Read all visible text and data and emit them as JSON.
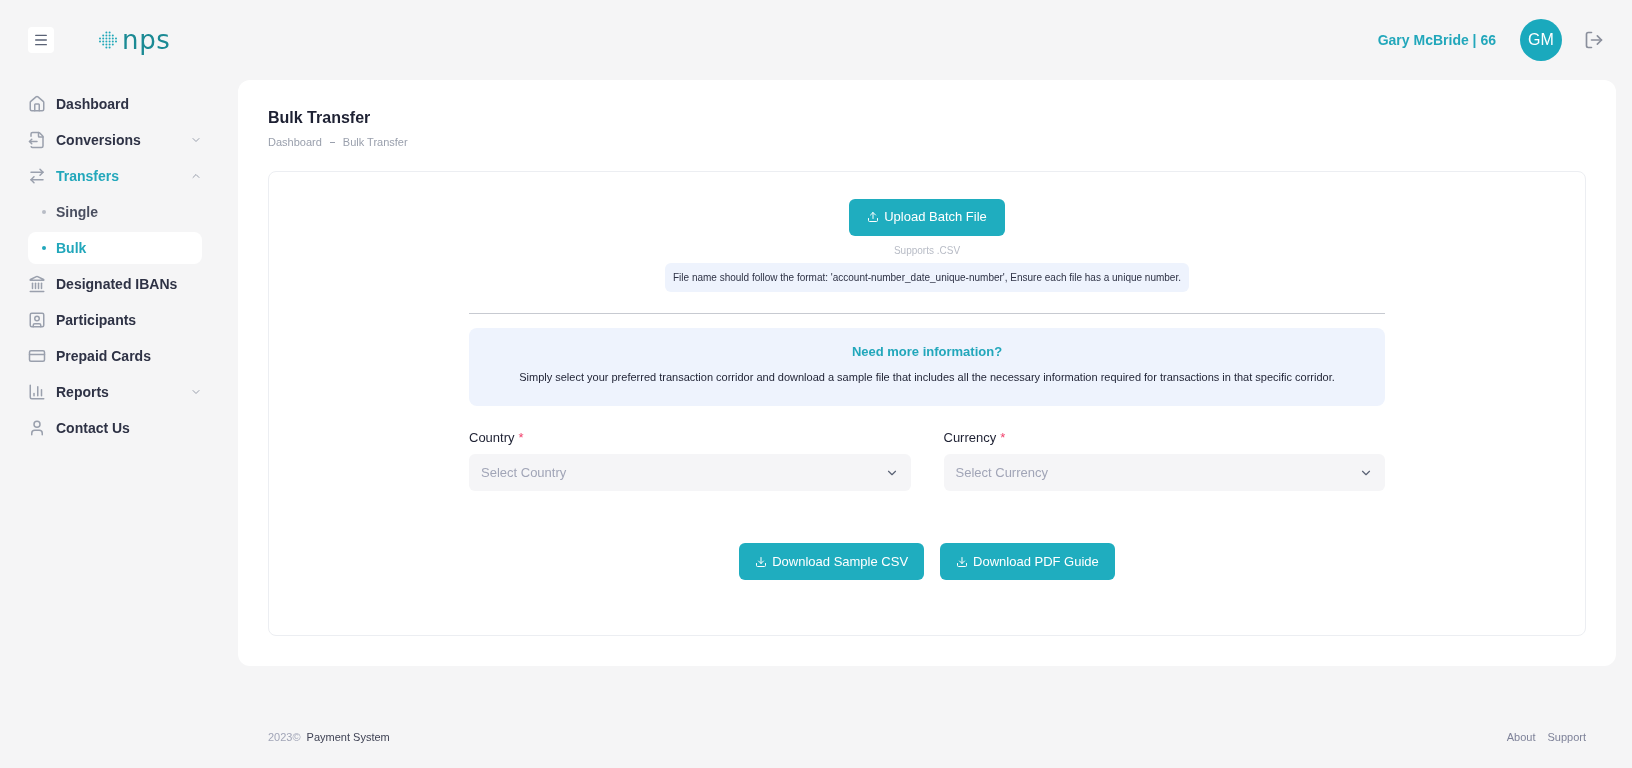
{
  "header": {
    "logo": "nps",
    "user": "Gary McBride | 66",
    "avatar": "GM"
  },
  "sidebar": {
    "items": [
      {
        "label": "Dashboard",
        "selected": false
      },
      {
        "label": "Conversions",
        "selected": false,
        "expanded": false
      },
      {
        "label": "Transfers",
        "selected": true,
        "expanded": true,
        "children": [
          {
            "label": "Single",
            "selected": false
          },
          {
            "label": "Bulk",
            "selected": true
          }
        ]
      },
      {
        "label": "Designated IBANs",
        "selected": false
      },
      {
        "label": "Participants",
        "selected": false
      },
      {
        "label": "Prepaid Cards",
        "selected": false
      },
      {
        "label": "Reports",
        "selected": false,
        "expanded": false
      },
      {
        "label": "Contact Us",
        "selected": false
      }
    ]
  },
  "page": {
    "title": "Bulk Transfer",
    "breadcrumb": [
      "Dashboard",
      "Bulk Transfer"
    ]
  },
  "upload": {
    "button": "Upload Batch File",
    "supports": "Supports .CSV",
    "note": "File name should follow the format: 'account-number_date_unique-number', Ensure each file has a unique number."
  },
  "info": {
    "title": "Need more information?",
    "text": "Simply select your preferred transaction corridor and download a sample file that includes all the necessary information required for transactions in that specific corridor."
  },
  "fields": [
    {
      "label": "Country",
      "required_mark": "*",
      "placeholder": "Select Country"
    },
    {
      "label": "Currency",
      "required_mark": "*",
      "placeholder": "Select Currency"
    }
  ],
  "actions": [
    "Download Sample CSV",
    "Download PDF Guide"
  ],
  "footer": {
    "year": "2023©",
    "company": "Payment System",
    "links": [
      "About",
      "Support"
    ]
  }
}
